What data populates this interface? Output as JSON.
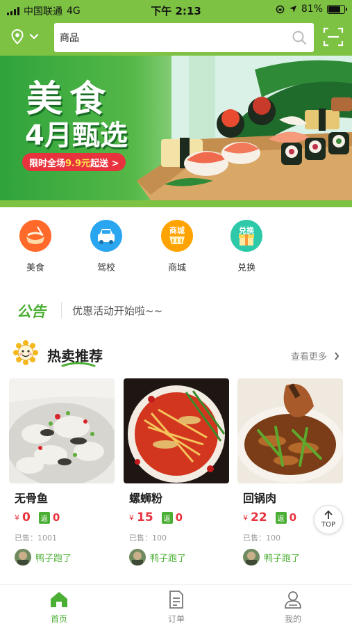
{
  "status_bar": {
    "carrier": "中国联通",
    "network": "4G",
    "time": "下午 2:13",
    "battery": "81%",
    "battery_level": 0.81
  },
  "header": {
    "location_icon": "location-pin-icon",
    "search_value": "商品",
    "search_icon": "search-icon",
    "scan_icon": "scan-icon"
  },
  "banner": {
    "title_line1": "美食",
    "title_line2": "4月甄选",
    "promo_prefix": "限时全场",
    "promo_highlight": "9.9元",
    "promo_suffix": "起送 >"
  },
  "categories": [
    {
      "label": "美食",
      "icon": "food-icon",
      "color": "#ff6a2a"
    },
    {
      "label": "驾校",
      "icon": "car-icon",
      "color": "#2aa6f0"
    },
    {
      "label": "商城",
      "icon": "mall-basket-icon",
      "badge": "商城",
      "color": "#ffa300"
    },
    {
      "label": "兑换",
      "icon": "gift-icon",
      "badge": "兑换",
      "color": "#2dc9a8"
    }
  ],
  "notice": {
    "tag": "公告",
    "text": "优惠活动开始啦~~"
  },
  "hot": {
    "title": "热卖推荐",
    "more": "查看更多",
    "mascot_icon": "sunflower-mascot-icon"
  },
  "products": [
    {
      "name": "无骨鱼",
      "currency": "¥",
      "price": "0",
      "rebate_label": "返",
      "rebate": "0",
      "sold": "已售：1001",
      "shop": "鸭子跑了"
    },
    {
      "name": "螺蛳粉",
      "currency": "¥",
      "price": "15",
      "rebate_label": "返",
      "rebate": "0",
      "sold": "已售：100",
      "shop": "鸭子跑了"
    },
    {
      "name": "回锅肉",
      "currency": "¥",
      "price": "22",
      "rebate_label": "返",
      "rebate": "0",
      "sold": "已售：100",
      "shop": "鸭子跑了"
    }
  ],
  "top_button": {
    "label": "TOP"
  },
  "tabbar": [
    {
      "label": "首页",
      "icon": "home-icon",
      "active": true
    },
    {
      "label": "订单",
      "icon": "order-list-icon",
      "active": false
    },
    {
      "label": "我的",
      "icon": "user-profile-icon",
      "active": false
    }
  ],
  "colors": {
    "brand_green": "#7dc243",
    "accent_green": "#4caf35",
    "price_red": "#e8323e"
  }
}
